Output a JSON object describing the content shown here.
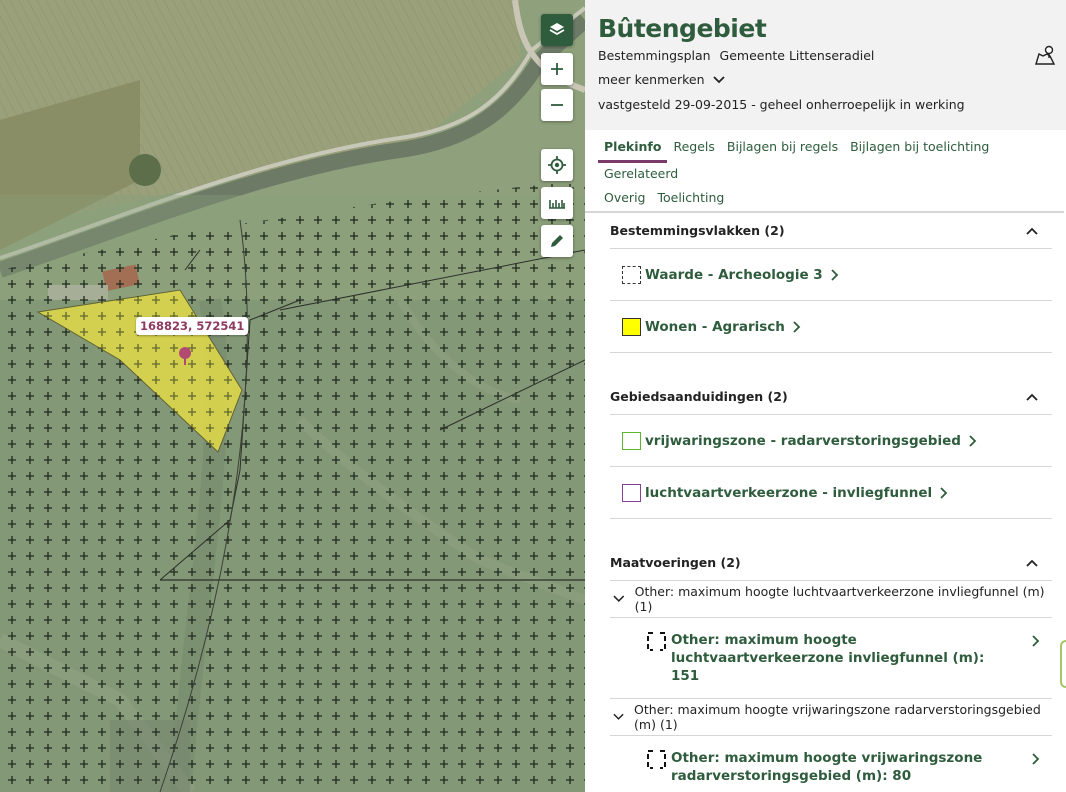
{
  "map": {
    "coordinate_label": "168823, 572541",
    "buttons": [
      "layers",
      "zoom-in",
      "zoom-out",
      "locate",
      "measure",
      "draw"
    ]
  },
  "panel": {
    "title": "Bûtengebiet",
    "plan_type": "Bestemmingsplan",
    "municipality": "Gemeente Littenseradiel",
    "more_features": "meer kenmerken",
    "status": "vastgesteld 29-09-2015 - geheel onherroepelijk in werking",
    "tabs": [
      "Plekinfo",
      "Regels",
      "Bijlagen bij regels",
      "Bijlagen bij toelichting",
      "Gerelateerd",
      "Overig",
      "Toelichting"
    ],
    "active_tab": "Plekinfo",
    "sections": {
      "bestemmingsvlakken": {
        "title": "Bestemmingsvlakken (2)",
        "items": [
          {
            "label": "Waarde - Archeologie 3",
            "swatch": "dashed"
          },
          {
            "label": "Wonen - Agrarisch",
            "swatch": "#ffff00"
          }
        ]
      },
      "gebiedsaanduidingen": {
        "title": "Gebiedsaanduidingen (2)",
        "items": [
          {
            "label": "vrijwaringszone - radarverstoringsgebied",
            "swatch": "#5bb82c"
          },
          {
            "label": "luchtvaartverkeerzone - invliegfunnel",
            "swatch": "#8a3e9c"
          }
        ]
      },
      "maatvoeringen": {
        "title": "Maatvoeringen (2)",
        "groups": [
          {
            "header": "Other: maximum hoogte luchtvaartverkeerzone invliegfunnel (m) (1)",
            "item": "Other: maximum hoogte luchtvaartverkeerzone invliegfunnel (m): 151"
          },
          {
            "header": "Other: maximum hoogte vrijwaringszone radarverstoringsgebied (m) (1)",
            "item": "Other: maximum hoogte vrijwaringszone radarverstoringsgebied (m): 80"
          }
        ]
      }
    }
  },
  "colors": {
    "brand_green": "#2e5c3c",
    "active_tab_underline": "#7a3b6b",
    "plot_yellow": "#e0d84a",
    "marker": "#b24b72"
  }
}
